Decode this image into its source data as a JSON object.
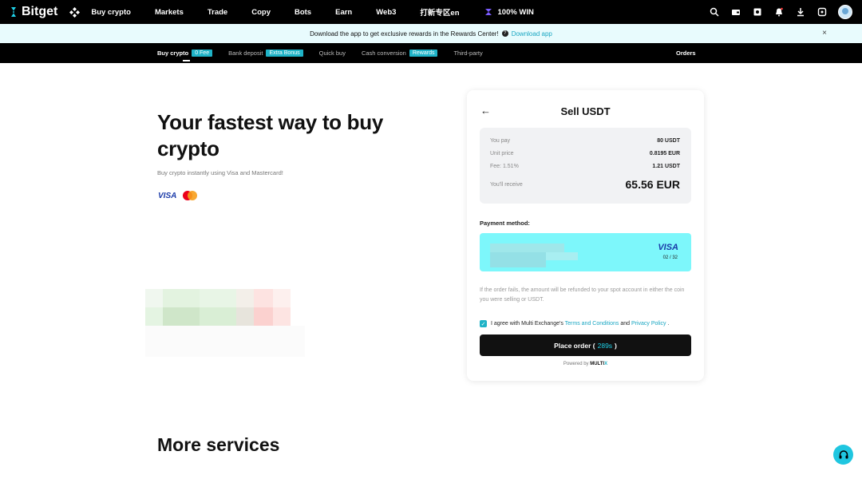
{
  "topnav": {
    "logo": "Bitget",
    "items": [
      "Buy crypto",
      "Markets",
      "Trade",
      "Copy",
      "Bots",
      "Earn",
      "Web3",
      "打新专区en"
    ],
    "win_label": "100% WIN"
  },
  "banner": {
    "text": "Download the app to get exclusive rewards in the Rewards Center!",
    "link": "Download app",
    "close": "×"
  },
  "subnav": {
    "items": [
      {
        "label": "Buy crypto",
        "tag": "0 Fee"
      },
      {
        "label": "Bank deposit",
        "tag": "Extra Bonus"
      },
      {
        "label": "Quick buy",
        "tag": ""
      },
      {
        "label": "Cash conversion",
        "tag": "Rewards"
      },
      {
        "label": "Third-party",
        "tag": ""
      }
    ],
    "orders": "Orders"
  },
  "hero": {
    "title": "Your fastest way to buy crypto",
    "subtitle": "Buy crypto instantly using Visa and Mastercard!",
    "visa": "VISA"
  },
  "sell_panel": {
    "back": "←",
    "title": "Sell USDT",
    "you_pay_label": "You pay",
    "you_pay_value": "80 USDT",
    "unit_price_label": "Unit price",
    "unit_price_value": "0.8195 EUR",
    "fee_label": "Fee: 1.51%",
    "fee_value": "1.21 USDT",
    "receive_label": "You'll receive",
    "receive_value": "65.56 EUR",
    "payment_method_label": "Payment method:",
    "card_brand": "VISA",
    "card_expiry": "02 / 32",
    "note": "If the order fails, the amount will be refunded to your spot account in either the coin you were selling or USDT.",
    "agree_prefix": "I agree with Multi Exchange's",
    "terms": "Terms and Conditions",
    "and": "and",
    "privacy": "Privacy Policy",
    "agree_suffix": ".",
    "place_order_label": "Place order (",
    "place_order_timer": "289s",
    "place_order_suffix": ")",
    "powered_by": "Powered by",
    "powered_brand": "MULTI",
    "powered_x": "X"
  },
  "more_services": "More services",
  "colors": {
    "accent": "#1fb3c7",
    "nav_bg": "#000000",
    "card": "#7df7fb"
  }
}
